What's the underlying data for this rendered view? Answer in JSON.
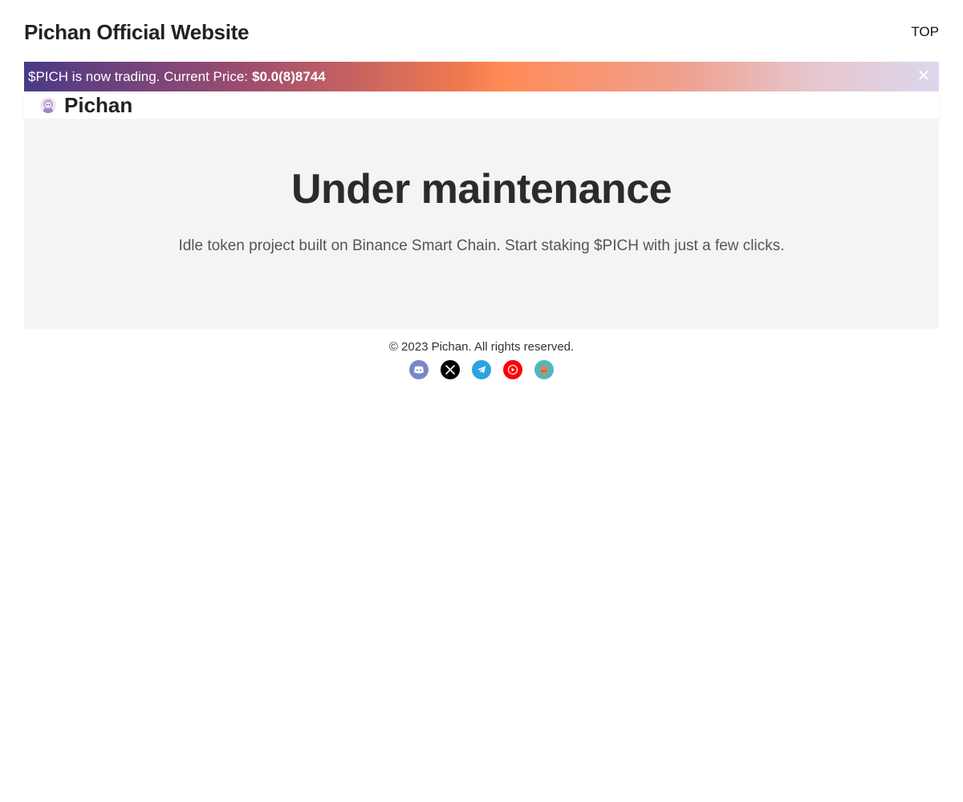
{
  "header": {
    "title": "Pichan Official Website",
    "top_link": "TOP"
  },
  "announcement": {
    "text": "$PICH is now trading. Current Price: ",
    "price": "$0.0(8)8744",
    "close_symbol": "✕"
  },
  "brand": {
    "name": "Pichan",
    "logo_icon": "pichan-avatar-icon"
  },
  "hero": {
    "title": "Under maintenance",
    "subtitle": "Idle token project built on Binance Smart Chain. Start staking $PICH with just a few clicks."
  },
  "footer": {
    "copyright": "© 2023 Pichan. All rights reserved.",
    "socials": [
      {
        "icon": "discord-icon",
        "color": "#7b87c7"
      },
      {
        "icon": "x-icon",
        "color": "#000000"
      },
      {
        "icon": "telegram-icon",
        "color": "#2aa3df"
      },
      {
        "icon": "youtube-icon",
        "color": "#ff0000"
      },
      {
        "icon": "pancakeswap-icon",
        "color": "#4fb7c4"
      }
    ]
  },
  "colors": {
    "hero_background": "#f4f4f4",
    "gradient_start": "#4a3a86",
    "gradient_mid": "#ff8a55",
    "gradient_end": "#ddd6ee"
  }
}
